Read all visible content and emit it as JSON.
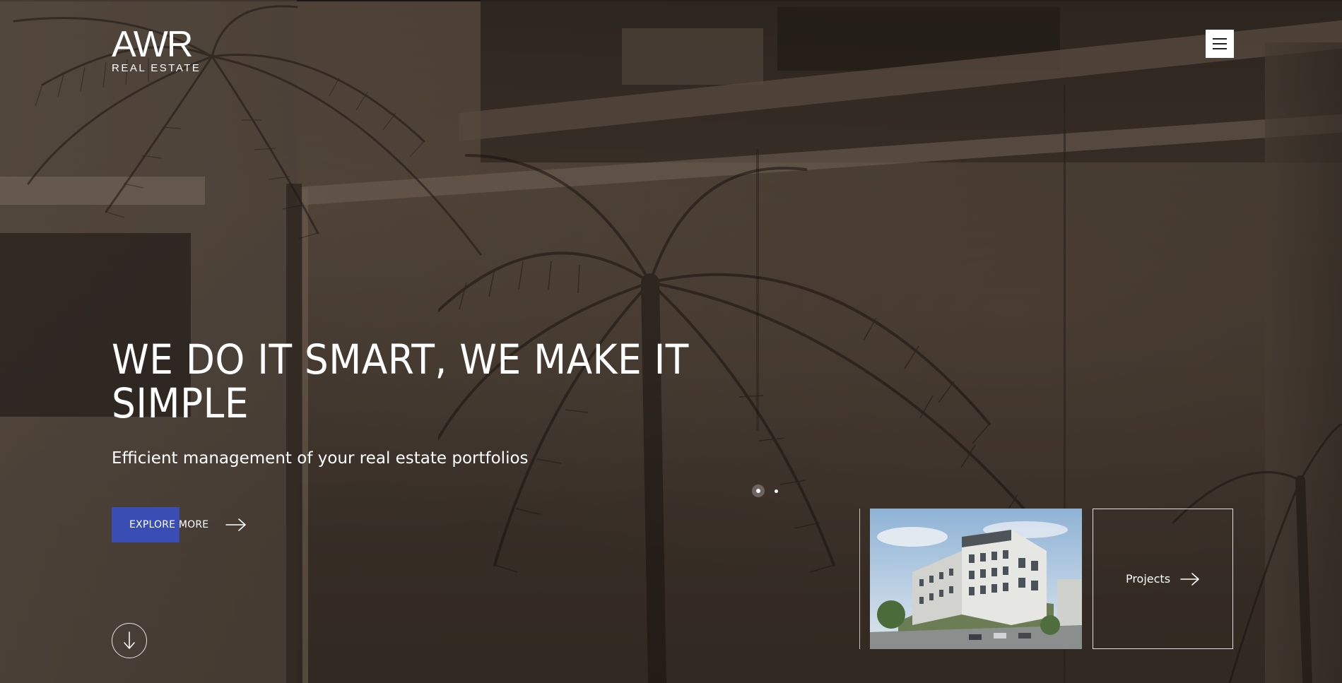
{
  "brand": {
    "logo_mark": "AWR",
    "logo_sub": "REAL ESTATE"
  },
  "header": {
    "menu_icon": "hamburger-menu-icon"
  },
  "hero": {
    "headline": "WE DO IT SMART, WE MAKE IT SIMPLE",
    "subheadline": "Efficient management of your real estate portfolios",
    "cta_label": "EXPLORE MORE",
    "cta_icon": "arrow-right-icon",
    "accent_color": "#3a4db5",
    "scroll_icon": "arrow-down-icon"
  },
  "slider": {
    "active_index": 1,
    "count": 2
  },
  "projects": {
    "label": "Projects",
    "icon": "arrow-right-icon",
    "thumbnail_alt": "apartment-building-render"
  }
}
